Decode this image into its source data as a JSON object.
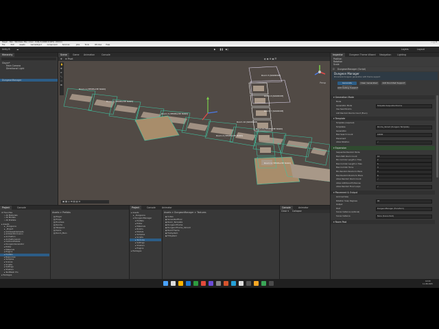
{
  "window": {
    "title": "Slayer - Dev - Windows, Mac, Linux - Unity 6 (6000.0.42f1) <DX11>"
  },
  "menubar": [
    "File",
    "Edit",
    "Assets",
    "GameObject",
    "Component",
    "Services",
    "Jobs",
    "Tools",
    "Window",
    "Help"
  ],
  "toolbar": {
    "account": "Unity B",
    "layers": "Layers",
    "layout": "Layout"
  },
  "hierarchy": {
    "tab": "Hierarchy",
    "items": [
      "Slayer*",
      "Main Camera",
      "Directional Light",
      "",
      "",
      "",
      "DungeonManager"
    ]
  },
  "scene": {
    "tabs": [
      "Scene",
      "Game",
      "Animation",
      "Console"
    ],
    "label_persp": "Persp",
    "rooms": [
      "Room 1 [TEMPLATE MAIN]",
      "Room 2 [TEMPLATE MAIN]",
      "Room 3 [TEMPLATE MAIN]",
      "Room 4 [TEMPLATE MAIN]",
      "Room 5 [RANDOM]",
      "Room 6 [RANDOM]",
      "Room 7 [RANDOM]",
      "Room 8 [TEMPLATE MAIN]",
      "Room 9 [TEMPLATE MAIN]",
      "Room 10 [RANDOM]"
    ]
  },
  "project": {
    "tabs": [
      "Project",
      "Console"
    ],
    "favorites": [
      "Favorites",
      "All Materials",
      "All Models",
      "All Prefabs"
    ],
    "assets": [
      "Assets",
      "_Dungeons",
      "_Project",
      "AddressableAssets",
      "AmbientOcclusion",
      "Animation",
      "AnimationsLink",
      "CartoonModels",
      "DungeonGenerator",
      "Editor",
      "Materials",
      "Plugins",
      "Prefabs",
      "Resources",
      "Samples",
      "Scenes",
      "Scripts",
      "Settings",
      "Shaders",
      "TextMesh Pro",
      "Packages"
    ],
    "breadcrumb": "Assets > Prefabs",
    "list": [
      "Player",
      "Props",
      "Enemies",
      "Rooms",
      "Weapons",
      "Items",
      "Room_Main"
    ]
  },
  "project2": {
    "tabs": [
      "Project",
      "Console",
      "Animator"
    ],
    "breadcrumb": "Assets > DungeonManager > Textures",
    "tree": [
      "Assets",
      "_Dungeons",
      "DungeonManager",
      "Prefabs",
      "Editor",
      "Materials",
      "Rooms",
      "Models",
      "Samples",
      "Scripts",
      "Textures",
      "Settings",
      "Shaders",
      "Plugins",
      "Packages"
    ],
    "files": [
      "Cubes",
      "GeneratedFloor",
      "Room_Template",
      "DungeonTheme",
      "DungeonTheme_Variant",
      "RoomTheme",
      "TileSystem",
      "FXSystem"
    ]
  },
  "inspector": {
    "tabs": [
      "Inspector",
      "Dungeon Theme Wizard",
      "Navigation",
      "Lighting"
    ],
    "object_name": "DungeonManager (Script)",
    "title": "Dungeon Manager",
    "subtitle": "Procedural dungeon generation with theme support",
    "buttons": [
      "Generate Dungeon",
      "Clear Generated",
      "Add RoomSet Support",
      "Add Ceiling Support"
    ],
    "sections": [
      {
        "name": "Generation Mode",
        "rows": [
          [
            "Mode",
            ""
          ],
          [
            "Generation Mode",
            "Template Sequential Rooms"
          ],
          [
            "Use Seed Rooms",
            ""
          ],
          [
            "Add Random Rooms Count (Even)",
            ""
          ]
        ]
      },
      {
        "name": "Template",
        "rows": [
          [
            "Template (required)",
            ""
          ],
          [
            "Templates",
            "Rooms_Variant (Dungeon Template)"
          ],
          [
            "Generation",
            ""
          ],
          [
            "Max Search Count",
            "10000"
          ],
          [
            "Placement",
            ""
          ],
          [
            "Allow Rotation",
            "✓"
          ]
        ]
      },
      {
        "name": "Expansion",
        "rows": [
          [
            "Sequential Random Mode",
            ""
          ],
          [
            "Main Path Room Count",
            "10"
          ],
          [
            "Min Corridor Length in Tiles",
            "2"
          ],
          [
            "Max Corridor Length in Tiles",
            "5"
          ],
          [
            "Max Corridor Turns",
            "3"
          ],
          [
            "Min Random Rooms to Place",
            "3"
          ],
          [
            "Max Random Rooms to Place",
            "6"
          ],
          [
            "Allow Random Room Count",
            "✓"
          ],
          [
            "Allow Additional Entrances",
            ""
          ],
          [
            "Allow Random Floor Loops",
            "✓"
          ]
        ]
      },
      {
        "name": "Placement & Output",
        "rows": [
          [
            "Grid Cell Size",
            ""
          ],
          [
            "Rotation Snap Degrees",
            "90"
          ],
          [
            "Output",
            ""
          ],
          [
            "Root",
            "DungeonManager (Transform)"
          ],
          [
            "Scene Instance (optional)",
            ""
          ],
          [
            "Scene Instance",
            "None (Scene Item)"
          ]
        ]
      },
      {
        "name": "Room Pool",
        "rows": []
      }
    ]
  },
  "taskbar": {
    "time": "14:00",
    "date": "11.08.2025"
  },
  "colors": {
    "accent": "#2c5d87",
    "wire": "#3fc3a1",
    "wire_white": "#ffffff",
    "floor": "#a89888",
    "floor_orange": "#a88d6b",
    "background_scene": "#504944"
  }
}
